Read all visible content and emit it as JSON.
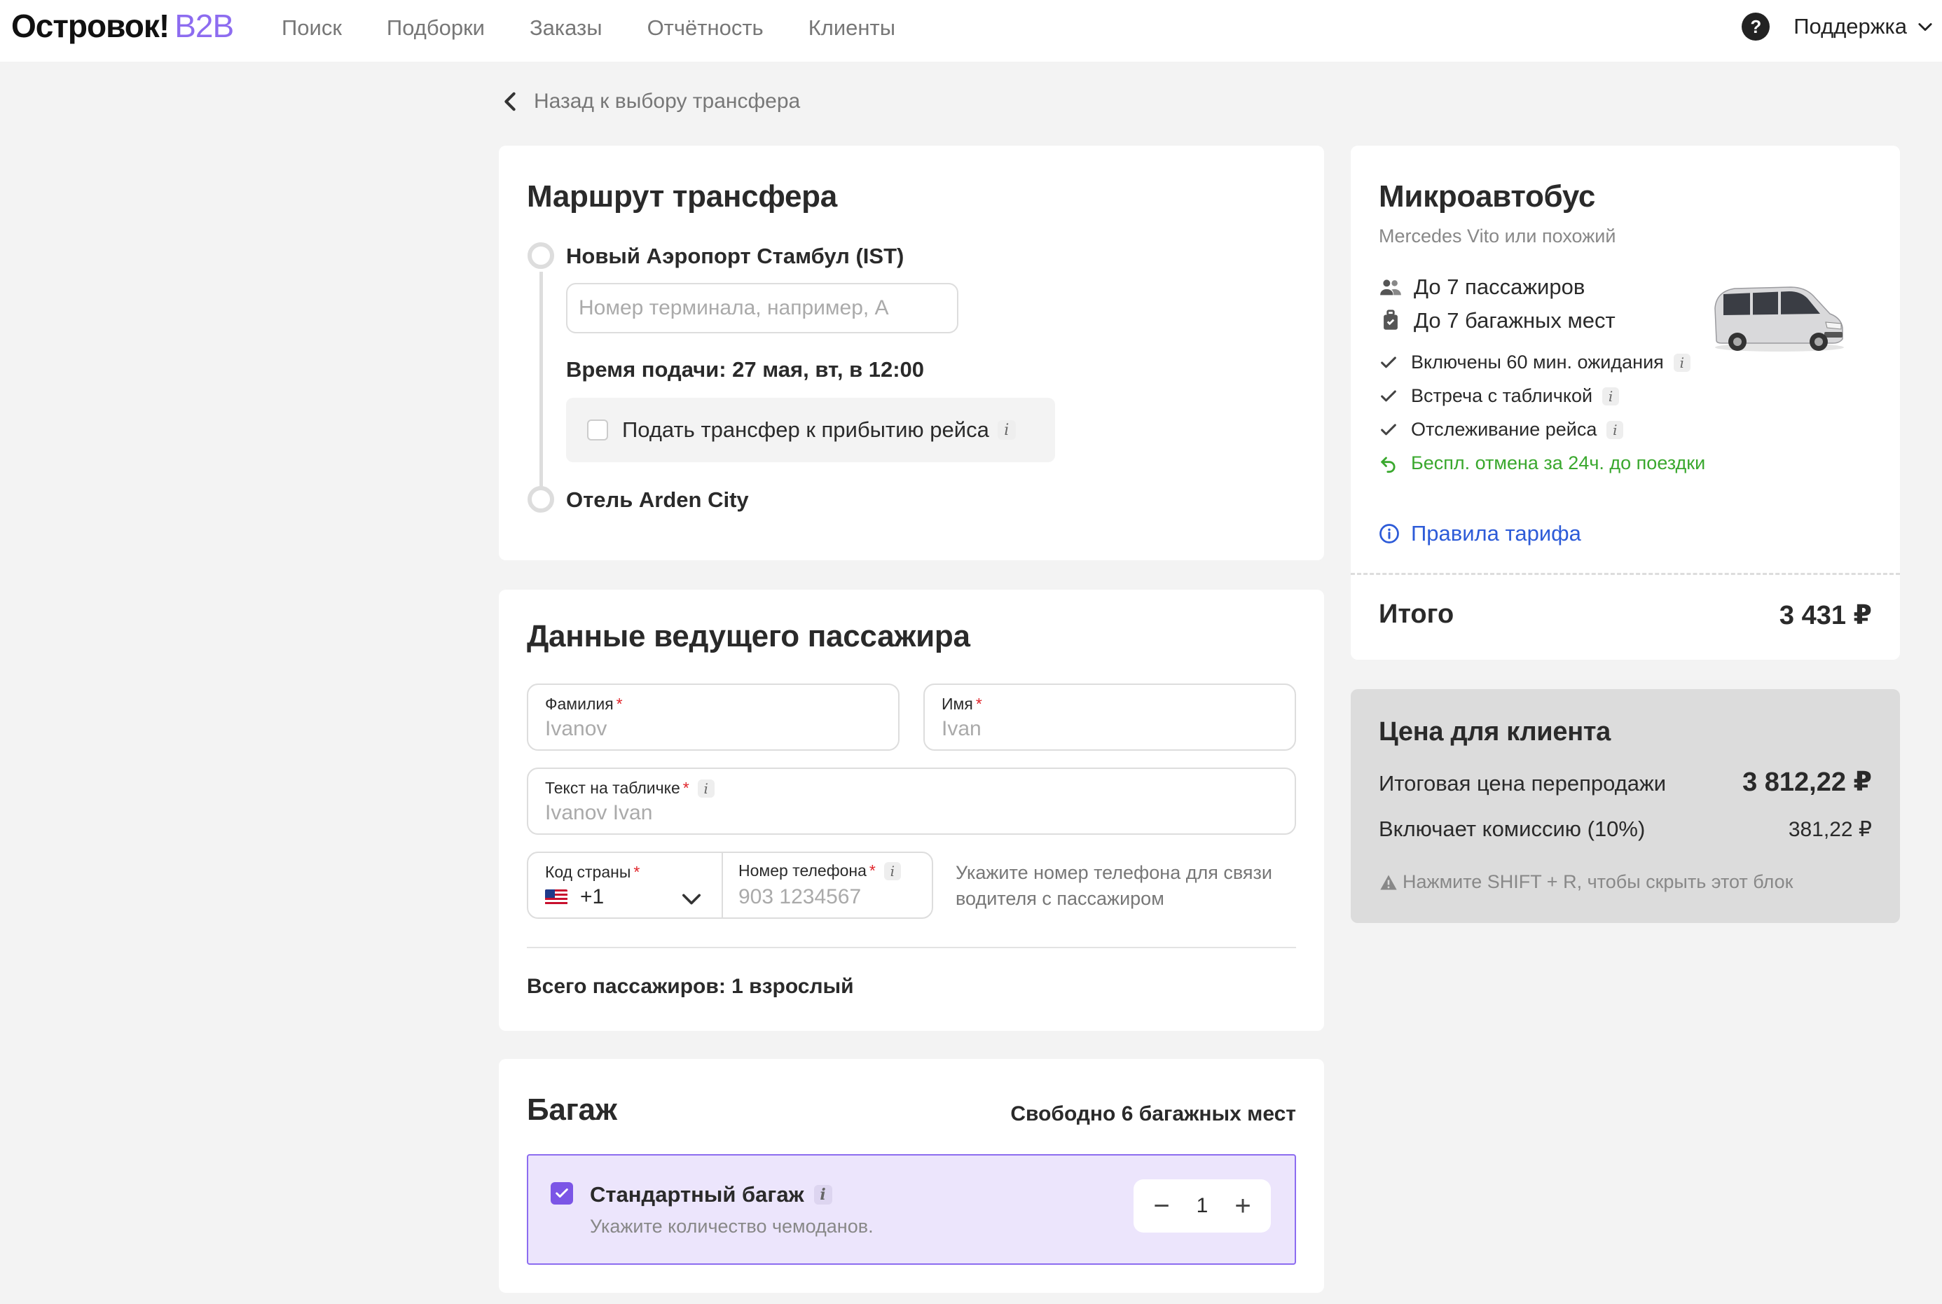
{
  "header": {
    "logo_main": "Островок!",
    "logo_b2b": "B2B",
    "nav": [
      "Поиск",
      "Подборки",
      "Заказы",
      "Отчётность",
      "Клиенты"
    ],
    "support_label": "Поддержка",
    "support_icon": "question-mark-icon"
  },
  "back": {
    "label": "Назад к выбору трансфера"
  },
  "route": {
    "title": "Маршрут трансфера",
    "from": "Новый Аэропорт Стамбул (IST)",
    "terminal_placeholder": "Номер терминала, например, А",
    "pickup_time": "Время подачи: 27 мая, вт, в 12:00",
    "arrival_option": "Подать трансфер к прибытию рейса",
    "arrival_checked": false,
    "to": "Отель Arden City"
  },
  "passenger": {
    "title": "Данные ведущего пассажира",
    "surname_label": "Фамилия",
    "surname_placeholder": "Ivanov",
    "name_label": "Имя",
    "name_placeholder": "Ivan",
    "sign_label": "Текст на табличке",
    "sign_placeholder": "Ivanov Ivan",
    "country_label": "Код страны",
    "country_code": "+1",
    "phone_label": "Номер телефона",
    "phone_placeholder": "903 1234567",
    "phone_hint": "Укажите номер телефона для связи водителя с пассажиром",
    "total": "Всего пассажиров: 1 взрослый",
    "required_mark": "*",
    "info_glyph": "i"
  },
  "baggage": {
    "title": "Багаж",
    "free": "Свободно 6 багажных мест",
    "item_title": "Стандартный багаж",
    "item_sub": "Укажите количество чемоданов.",
    "checked": true,
    "quantity": "1",
    "minus": "−",
    "plus": "+"
  },
  "vehicle": {
    "title": "Микроавтобус",
    "subtitle": "Mercedes Vito или похожий",
    "passengers": "До 7 пассажиров",
    "luggage": "До 7 багажных мест",
    "features": [
      "Включены 60 мин. ожидания",
      "Встреча с табличкой",
      "Отслеживание рейса"
    ],
    "cancellation": "Беспл. отмена за 24ч. до поездки",
    "tariff_link": "Правила тарифа",
    "total_label": "Итого",
    "total_value": "3 431 ₽"
  },
  "client_price": {
    "title": "Цена для клиента",
    "resale_label": "Итоговая цена перепродажи",
    "resale_value": "3 812,22 ₽",
    "commission_label": "Включает комиссию (10%)",
    "commission_value": "381,22 ₽",
    "hint": "Нажмите SHIFT + R, чтобы скрыть этот блок"
  },
  "colors": {
    "accent_purple": "#7b55e6",
    "link_blue": "#2d5bd8",
    "success_green": "#3aa82e",
    "required_red": "#e0252b"
  }
}
